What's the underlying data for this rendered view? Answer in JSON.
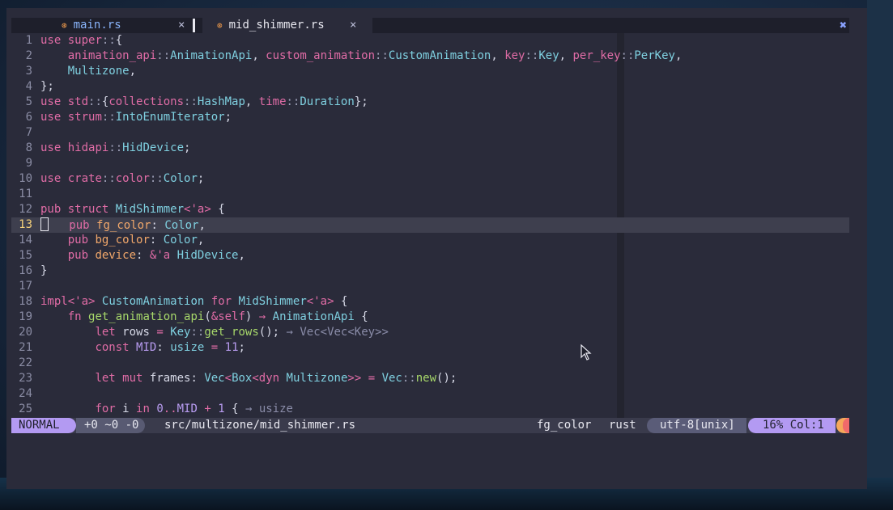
{
  "tabs": [
    {
      "name": "main.rs",
      "icon": "rust-file-icon",
      "active": true,
      "close": "×"
    },
    {
      "name": "mid_shimmer.rs",
      "icon": "rust-file-icon",
      "active": false,
      "close": "×"
    }
  ],
  "close_all": "✖",
  "lines": [
    {
      "n": "1",
      "html": "<span class='k'>use</span> <span class='m'>super</span><span class='sep'>::</span>{"
    },
    {
      "n": "2",
      "html": "    <span class='m'>animation_api</span><span class='sep'>::</span><span class='t'>AnimationApi</span>, <span class='m'>custom_animation</span><span class='sep'>::</span><span class='t'>CustomAnimation</span>, <span class='m'>key</span><span class='sep'>::</span><span class='t'>Key</span>, <span class='m'>per_key</span><span class='sep'>::</span><span class='t'>PerKey</span>,"
    },
    {
      "n": "3",
      "html": "    <span class='t'>Multizone</span>,"
    },
    {
      "n": "4",
      "html": "};"
    },
    {
      "n": "5",
      "html": "<span class='k'>use</span> <span class='m'>std</span><span class='sep'>::</span>{<span class='m'>collections</span><span class='sep'>::</span><span class='t'>HashMap</span>, <span class='m'>time</span><span class='sep'>::</span><span class='t'>Duration</span>};"
    },
    {
      "n": "6",
      "html": "<span class='k'>use</span> <span class='m'>strum</span><span class='sep'>::</span><span class='t'>IntoEnumIterator</span>;"
    },
    {
      "n": "7",
      "html": ""
    },
    {
      "n": "8",
      "html": "<span class='k'>use</span> <span class='m'>hidapi</span><span class='sep'>::</span><span class='t'>HidDevice</span>;"
    },
    {
      "n": "9",
      "html": ""
    },
    {
      "n": "10",
      "html": "<span class='k'>use</span> <span class='m'>crate</span><span class='sep'>::</span><span class='m'>color</span><span class='sep'>::</span><span class='t'>Color</span>;"
    },
    {
      "n": "11",
      "html": ""
    },
    {
      "n": "12",
      "html": "<span class='k'>pub</span> <span class='k'>struct</span> <span class='t'>MidShimmer</span><span class='o'>&lt;</span><span class='k'>'a</span><span class='o'>&gt;</span> {"
    },
    {
      "n": "13",
      "html": "<span class='cursor'></span>   <span class='k'>pub</span> <span class='p'>fg_color</span>: <span class='t'>Color</span>,",
      "cur": true
    },
    {
      "n": "14",
      "html": "    <span class='k'>pub</span> <span class='p'>bg_color</span>: <span class='t'>Color</span>,"
    },
    {
      "n": "15",
      "html": "    <span class='k'>pub</span> <span class='p'>device</span>: <span class='o'>&amp;</span><span class='k'>'a</span> <span class='t'>HidDevice</span>,"
    },
    {
      "n": "16",
      "html": "}"
    },
    {
      "n": "17",
      "html": ""
    },
    {
      "n": "18",
      "html": "<span class='k'>impl</span><span class='o'>&lt;</span><span class='k'>'a</span><span class='o'>&gt;</span> <span class='t'>CustomAnimation</span> <span class='k'>for</span> <span class='t'>MidShimmer</span><span class='o'>&lt;</span><span class='k'>'a</span><span class='o'>&gt;</span> {"
    },
    {
      "n": "19",
      "html": "    <span class='k'>fn</span> <span class='f'>get_animation_api</span>(<span class='o'>&amp;</span><span class='k'>self</span>) <span class='o'>→</span> <span class='t'>AnimationApi</span> {"
    },
    {
      "n": "20",
      "html": "        <span class='k'>let</span> rows <span class='o'>=</span> <span class='t'>Key</span><span class='sep'>::</span><span class='f'>get_rows</span>(); <span class='hint'>→ Vec&lt;Vec&lt;Key&gt;&gt;</span>"
    },
    {
      "n": "21",
      "html": "        <span class='k'>const</span> <span class='n'>MID</span>: <span class='t'>usize</span> <span class='o'>=</span> <span class='n'>11</span>;"
    },
    {
      "n": "22",
      "html": ""
    },
    {
      "n": "23",
      "html": "        <span class='k'>let</span> <span class='k'>mut</span> frames: <span class='t'>Vec</span><span class='o'>&lt;</span><span class='t'>Box</span><span class='o'>&lt;</span><span class='k'>dyn</span> <span class='t'>Multizone</span><span class='o'>&gt;&gt;</span> <span class='o'>=</span> <span class='t'>Vec</span><span class='sep'>::</span><span class='f'>new</span>();"
    },
    {
      "n": "24",
      "html": ""
    },
    {
      "n": "25",
      "html": "        <span class='k'>for</span> i <span class='k'>in</span> <span class='n'>0</span><span class='o'>..</span><span class='n'>MID</span> <span class='o'>+</span> <span class='n'>1</span> { <span class='hint'>→ usize</span>"
    }
  ],
  "status": {
    "mode": "NORMAL",
    "diff": "+0 ~0 -0",
    "path": "src/multizone/mid_shimmer.rs",
    "scope": "fg_color",
    "filetype": "rust",
    "encoding": "utf-8[unix]",
    "position": "16% Col:1"
  },
  "colors": {
    "mode_bg": "#b39af2",
    "editor_bg": "#2a2b3a",
    "keyword": "#e06ca6",
    "type": "#7fd0e0",
    "field": "#f2a86b"
  }
}
